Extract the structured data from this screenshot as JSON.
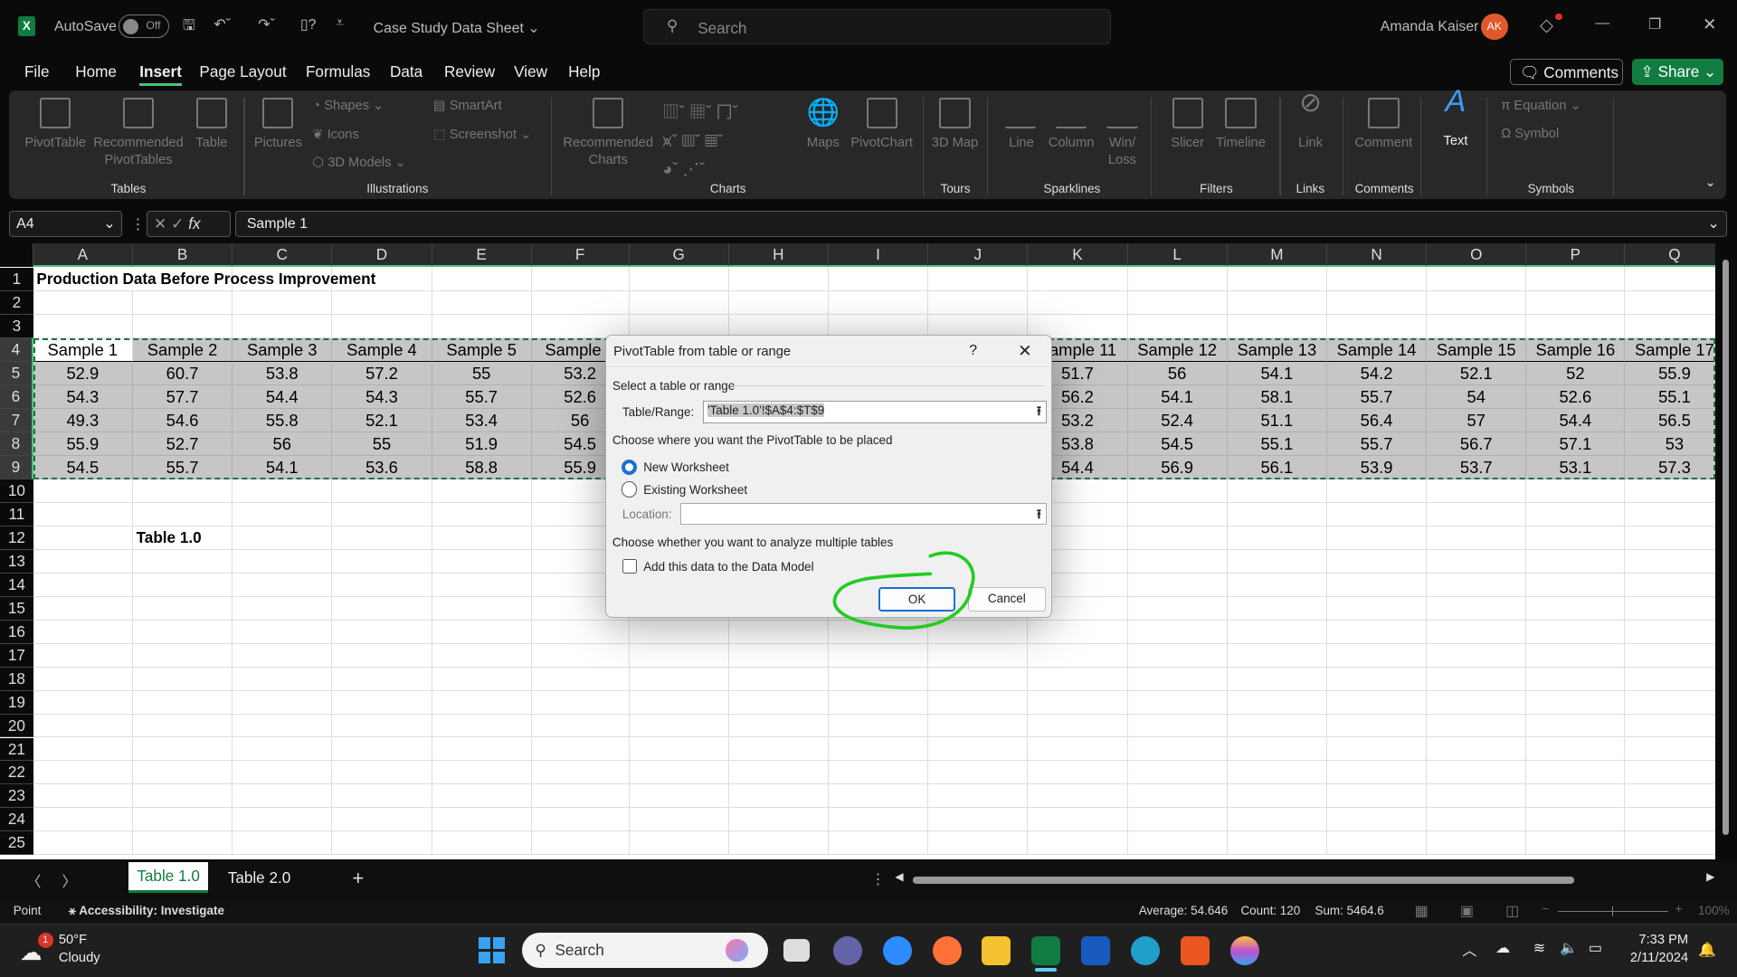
{
  "titlebar": {
    "autosave_label": "AutoSave",
    "autosave_state": "Off",
    "doc_title": "Case Study Data Sheet",
    "search_placeholder": "Search",
    "user_name": "Amanda Kaiser",
    "user_initials": "AK"
  },
  "menu": {
    "tabs": [
      "File",
      "Home",
      "Insert",
      "Page Layout",
      "Formulas",
      "Data",
      "Review",
      "View",
      "Help"
    ],
    "active": "Insert",
    "comments_label": "Comments",
    "share_label": "Share"
  },
  "ribbon": {
    "groups": [
      "Tables",
      "Illustrations",
      "Charts",
      "Tours",
      "Sparklines",
      "Filters",
      "Links",
      "Comments",
      "Symbols"
    ],
    "tables": [
      "PivotTable",
      "Recommended PivotTables",
      "Table"
    ],
    "illustrations": {
      "pictures": "Pictures",
      "shapes": "Shapes",
      "icons": "Icons",
      "models": "3D Models",
      "smartart": "SmartArt",
      "screenshot": "Screenshot"
    },
    "charts": {
      "recommended": "Recommended Charts",
      "maps": "Maps",
      "pivotchart": "PivotChart"
    },
    "tours": "3D Map",
    "sparklines": [
      "Line",
      "Column",
      "Win/ Loss"
    ],
    "filters": [
      "Slicer",
      "Timeline"
    ],
    "link": "Link",
    "comment": "Comment",
    "text": "Text",
    "equation": "Equation",
    "symbol": "Symbol"
  },
  "formula_bar": {
    "name_box": "A4",
    "formula": "Sample 1",
    "fx": "fx"
  },
  "sheet": {
    "columns": [
      "A",
      "B",
      "C",
      "D",
      "E",
      "F",
      "G",
      "H",
      "I",
      "J",
      "K",
      "L",
      "M",
      "N",
      "O",
      "P",
      "Q"
    ],
    "title": "Production Data Before Process Improvement",
    "caption": "Table 1.0",
    "headers": [
      "Sample 1",
      "Sample 2",
      "Sample 3",
      "Sample 4",
      "Sample 5",
      "Sample 6",
      "",
      "",
      "",
      "",
      "Sample 11",
      "Sample 12",
      "Sample 13",
      "Sample 14",
      "Sample 15",
      "Sample 16",
      "Sample 17"
    ],
    "rows": [
      [
        "52.9",
        "60.7",
        "53.8",
        "57.2",
        "55",
        "53.2",
        "",
        "",
        "",
        "",
        "51.7",
        "56",
        "54.1",
        "54.2",
        "52.1",
        "52",
        "55.9"
      ],
      [
        "54.3",
        "57.7",
        "54.4",
        "54.3",
        "55.7",
        "52.6",
        "",
        "",
        "",
        "",
        "56.2",
        "54.1",
        "58.1",
        "55.7",
        "54",
        "52.6",
        "55.1"
      ],
      [
        "49.3",
        "54.6",
        "55.8",
        "52.1",
        "53.4",
        "56",
        "",
        "",
        "",
        "",
        "53.2",
        "52.4",
        "51.1",
        "56.4",
        "57",
        "54.4",
        "56.5"
      ],
      [
        "55.9",
        "52.7",
        "56",
        "55",
        "51.9",
        "54.5",
        "",
        "",
        "",
        "",
        "53.8",
        "54.5",
        "55.1",
        "55.7",
        "56.7",
        "57.1",
        "53"
      ],
      [
        "54.5",
        "55.7",
        "54.1",
        "53.6",
        "58.8",
        "55.9",
        "",
        "",
        "",
        "",
        "54.4",
        "56.9",
        "56.1",
        "53.9",
        "53.7",
        "53.1",
        "57.3"
      ]
    ]
  },
  "dialog": {
    "title": "PivotTable from table or range",
    "help": "?",
    "section1": "Select a table or range",
    "range_label": "Table/Range:",
    "range_value": "'Table 1.0'!$A$4:$T$9",
    "section2": "Choose where you want the PivotTable to be placed",
    "opt_new": "New Worksheet",
    "opt_existing": "Existing Worksheet",
    "selected": "New Worksheet",
    "location_label": "Location:",
    "location_value": "",
    "section3": "Choose whether you want to analyze multiple tables",
    "checkbox_label": "Add this data to the Data Model",
    "checkbox_checked": false,
    "ok": "OK",
    "cancel": "Cancel",
    "annotation_color": "#22cc22"
  },
  "sheet_tabs": {
    "tabs": [
      "Table 1.0",
      "Table 2.0"
    ],
    "active": "Table 1.0"
  },
  "status": {
    "mode": "Point",
    "accessibility": "Accessibility: Investigate",
    "average": "Average: 54.646",
    "count": "Count: 120",
    "sum": "Sum: 5464.6",
    "zoom": "100%"
  },
  "taskbar": {
    "temp": "50°F",
    "weather": "Cloudy",
    "weather_badge": "1",
    "search": "Search",
    "time": "7:33 PM",
    "date": "2/11/2024"
  },
  "colors": {
    "accent": "#107c41",
    "selection": "#c6c6c6",
    "text_blue": "#3b9cff"
  }
}
